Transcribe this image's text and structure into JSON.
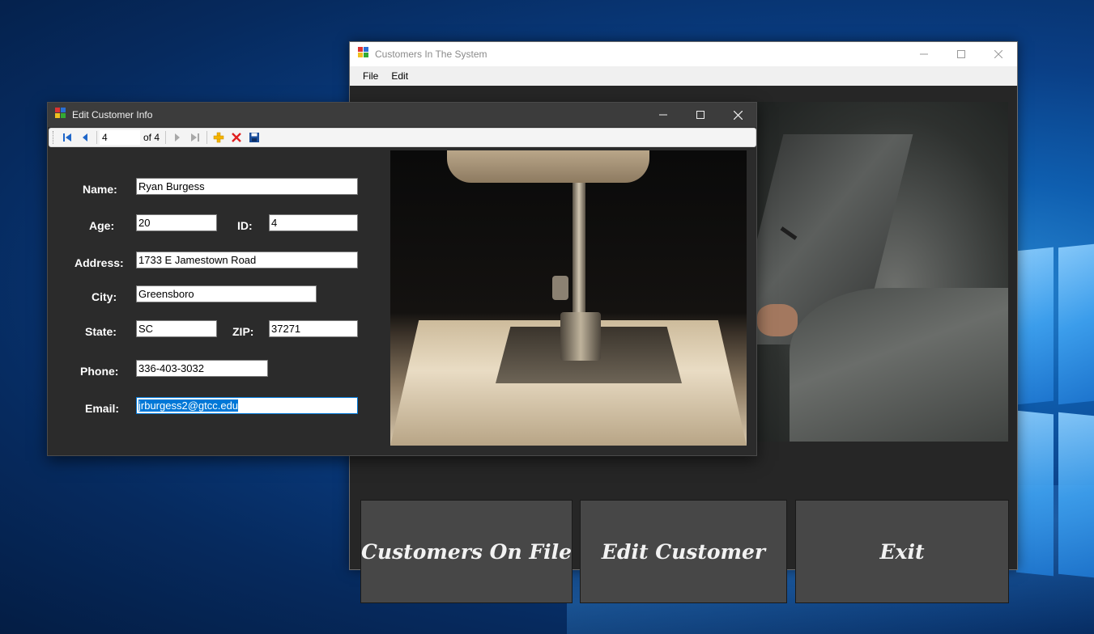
{
  "main_window": {
    "title": "Customers In The System",
    "menu": [
      "File",
      "Edit"
    ],
    "buttons": {
      "customers_on_file": "Customers On File",
      "edit_customer": "Edit Customer",
      "exit": "Exit"
    }
  },
  "edit_window": {
    "title": "Edit Customer Info",
    "navigator": {
      "position": "4",
      "count_label": "of 4"
    },
    "labels": {
      "name": "Name:",
      "age": "Age:",
      "id": "ID:",
      "address": "Address:",
      "city": "City:",
      "state": "State:",
      "zip": "ZIP:",
      "phone": "Phone:",
      "email": "Email:"
    },
    "fields": {
      "name": "Ryan Burgess",
      "age": "20",
      "id": "4",
      "address": "1733 E Jamestown Road",
      "city": "Greensboro",
      "state": "SC",
      "zip": "37271",
      "phone": "336-403-3032",
      "email": "jrburgess2@gtcc.edu"
    }
  },
  "icons": {
    "nav_first": "move-first-icon",
    "nav_prev": "move-previous-icon",
    "nav_next": "move-next-icon",
    "nav_last": "move-last-icon",
    "add": "add-new-icon",
    "delete": "delete-icon",
    "save": "save-icon"
  },
  "colors": {
    "selection": "#0078d7",
    "add_icon": "#f5b400",
    "delete_icon": "#e02020",
    "save_icon": "#1b4f9c"
  }
}
